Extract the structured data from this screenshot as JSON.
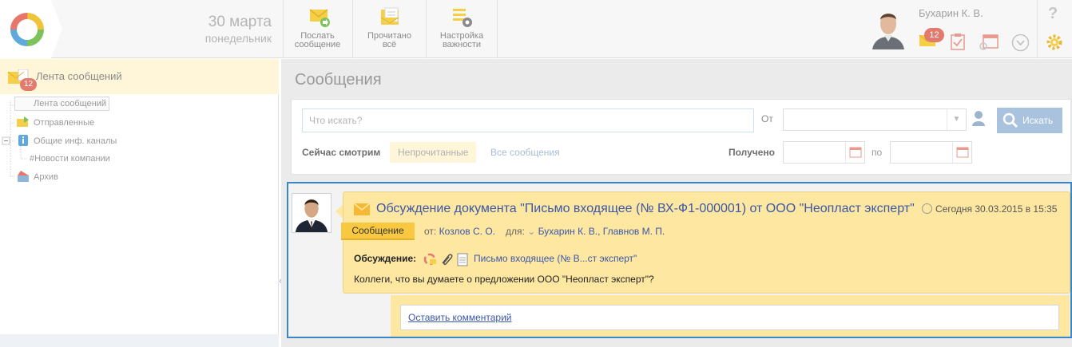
{
  "header": {
    "date_day": "30 марта",
    "date_weekday": "понедельник",
    "toolbar": [
      {
        "label": "Послать\nсообщение",
        "icon": "send-message-icon"
      },
      {
        "label": "Прочитано\nвсё",
        "icon": "mark-read-icon"
      },
      {
        "label": "Настройка\nважности",
        "icon": "importance-settings-icon"
      }
    ],
    "user_name": "Бухарин К. В.",
    "unread_badge": "12",
    "help": "?"
  },
  "sidebar": {
    "head_label": "Лента сообщений",
    "head_badge": "12",
    "tree": [
      {
        "label": "Лента сообщений",
        "selected": true
      },
      {
        "label": "Отправленные"
      },
      {
        "label": "Общие инф. каналы"
      },
      {
        "label": "#Новости компании"
      },
      {
        "label": "Архив"
      }
    ]
  },
  "main": {
    "title": "Сообщения",
    "filter": {
      "search_placeholder": "Что искать?",
      "from_label": "От",
      "search_button": "Искать",
      "now_label": "Сейчас смотрим",
      "tab_unread": "Непрочитанные",
      "tab_all": "Все сообщения",
      "received_label": "Получено",
      "to_label": "по"
    },
    "message": {
      "title": "Обсуждение документа \"Письмо входящее (№ ВХ-Ф1-000001) от ООО \"Неопласт эксперт\"",
      "time": "Сегодня 30.03.2015 в 15:35",
      "type": "Сообщение",
      "from_prefix": "от:",
      "from": "Козлов С. О.",
      "for_prefix": "для:",
      "to": "Бухарин К. В., Главнов М. П.",
      "discussion_label": "Обсуждение:",
      "discussion_link": "Письмо входящее (№ В...ст эксперт\"",
      "body": "Коллеги, что вы думаете о предложении ООО \"Неопласт эксперт\"?",
      "comment_link": "Оставить комментарий"
    }
  },
  "colors": {
    "accent_blue": "#3a87c8",
    "message_bg": "#fde7a1",
    "type_chip": "#f7c840",
    "badge": "#e27b6e"
  }
}
